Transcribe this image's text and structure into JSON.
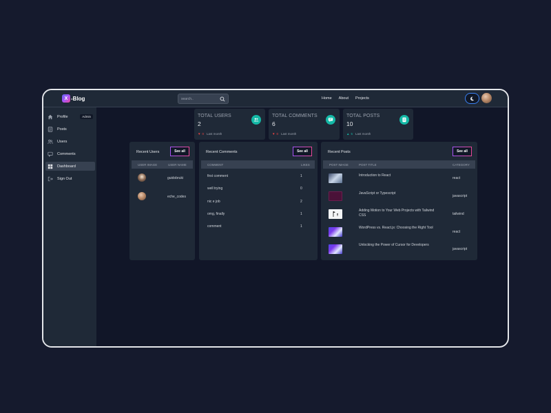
{
  "app": {
    "logo_mark": "X",
    "logo_text": "-Blog",
    "search_placeholder": "search..",
    "nav": [
      "Home",
      "About",
      "Projects"
    ]
  },
  "sidebar": {
    "items": [
      {
        "label": "Profile",
        "icon": "home-icon",
        "badge": "Admin",
        "active": false
      },
      {
        "label": "Posts",
        "icon": "document-icon",
        "active": false
      },
      {
        "label": "Users",
        "icon": "users-icon",
        "active": false
      },
      {
        "label": "Comments",
        "icon": "comments-icon",
        "active": false
      },
      {
        "label": "Dashboard",
        "icon": "dashboard-icon",
        "active": true
      },
      {
        "label": "Sign Out",
        "icon": "sign-out-icon",
        "active": false
      }
    ]
  },
  "stats": [
    {
      "title": "TOTAL USERS",
      "value": "2",
      "delta": "0",
      "trend": "down",
      "period": "Last month",
      "icon": "users-icon",
      "color": "#14b8a6"
    },
    {
      "title": "TOTAL COMMENTS",
      "value": "6",
      "delta": "0",
      "trend": "down",
      "period": "Last month",
      "icon": "chat-icon",
      "color": "#14b8a6"
    },
    {
      "title": "TOTAL POSTS",
      "value": "10",
      "delta": "5",
      "trend": "up",
      "period": "Last month",
      "icon": "document-icon",
      "color": "#14b8a6"
    }
  ],
  "recent_users": {
    "title": "Recent Users",
    "see_all": "See all",
    "columns": [
      "User image",
      "User name"
    ],
    "rows": [
      {
        "username": "guidobruki"
      },
      {
        "username": "eche_codes"
      }
    ]
  },
  "recent_comments": {
    "title": "Recent Comments",
    "see_all": "See all",
    "columns": [
      "Comment",
      "Likes"
    ],
    "rows": [
      {
        "comment": "first comment",
        "likes": "1"
      },
      {
        "comment": "well trying",
        "likes": "0"
      },
      {
        "comment": "nic e job",
        "likes": "2"
      },
      {
        "comment": "omg, finally",
        "likes": "1"
      },
      {
        "comment": "comment",
        "likes": "1"
      }
    ]
  },
  "recent_posts": {
    "title": "Recent Posts",
    "see_all": "See all",
    "columns": [
      "Post image",
      "Post Title",
      "Category"
    ],
    "rows": [
      {
        "title_line1": "Introduction to React",
        "title_line2": "",
        "category": "react"
      },
      {
        "title_line1": "JavaScript or Typescript",
        "title_line2": "",
        "category": "javascript"
      },
      {
        "title_line1": "Adding Motion to Your Web Projects with Tailwind",
        "title_line2": "CSS",
        "category": "tailwind"
      },
      {
        "title_line1": "WordPress vs. React.js: Choosing the Right Tool",
        "title_line2": "",
        "category": "react"
      },
      {
        "title_line1": "Unlocking the Power of Cursor for Developers",
        "title_line2": "",
        "category": "javascript"
      }
    ]
  }
}
